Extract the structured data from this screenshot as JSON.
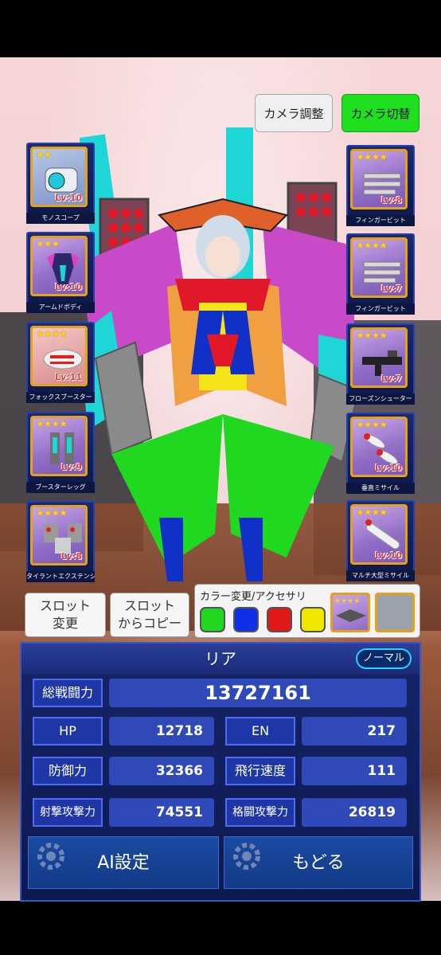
{
  "top_buttons": {
    "camera_adjust": "カメラ調整",
    "camera_switch": "カメラ切替"
  },
  "left_slots": [
    {
      "name": "モノスコープ",
      "stars": "★★",
      "level": "Lv:10"
    },
    {
      "name": "アームドボディ",
      "stars": "★★★",
      "level": "Lv:10"
    },
    {
      "name": "フォックスブースター",
      "stars": "★★★★",
      "level": "Lv:11"
    },
    {
      "name": "ブースターレッグ",
      "stars": "★★★★",
      "level": "Lv:9"
    },
    {
      "name": "タイラントエクステンションⅡ",
      "stars": "★★★★",
      "level": "Lv:8"
    }
  ],
  "right_slots": [
    {
      "name": "フィンガービット",
      "stars": "★★★★",
      "level": "Lv:8"
    },
    {
      "name": "フィンガービット",
      "stars": "★★★★",
      "level": "Lv:7"
    },
    {
      "name": "フローズンシューター",
      "stars": "★★★★",
      "level": "Lv:7"
    },
    {
      "name": "垂直ミサイル",
      "stars": "★★★★",
      "level": "Lv:10"
    },
    {
      "name": "マルチ大型ミサイル",
      "stars": "★★★★",
      "level": "Lv:10"
    }
  ],
  "actions": {
    "slot_change": [
      "スロット",
      "変更"
    ],
    "slot_copy": [
      "スロット",
      "からコピー"
    ]
  },
  "color_panel": {
    "title": "カラー変更/アクセサリ",
    "colors": [
      "#1fd81f",
      "#1030e8",
      "#e01818",
      "#f0e800"
    ]
  },
  "character": {
    "name": "リア",
    "mode": "ノーマル"
  },
  "stats": {
    "total_label": "総戦闘力",
    "total_value": "13727161",
    "hp_label": "HP",
    "hp_value": "12718",
    "en_label": "EN",
    "en_value": "217",
    "def_label": "防御力",
    "def_value": "32366",
    "speed_label": "飛行速度",
    "speed_value": "111",
    "shoot_label": "射撃攻撃力",
    "shoot_value": "74551",
    "melee_label": "格闘攻撃力",
    "melee_value": "26819"
  },
  "bottom": {
    "ai_label": "AI設定",
    "back_label": "もどる"
  }
}
